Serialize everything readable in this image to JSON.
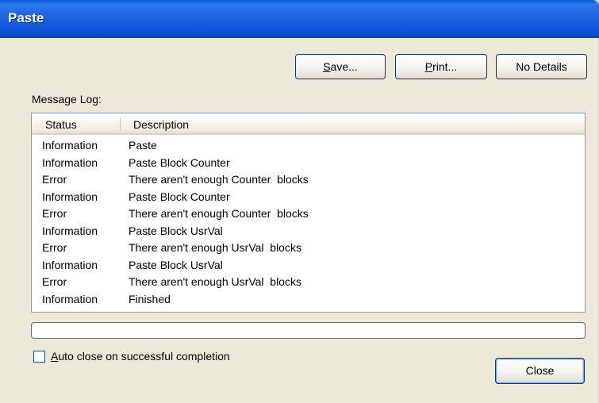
{
  "window": {
    "title": "Paste"
  },
  "toolbar": {
    "save_label": "Save...",
    "print_label": "Print...",
    "details_label": "No Details"
  },
  "log": {
    "label": "Message Log:",
    "columns": [
      "Status",
      "Description"
    ],
    "rows": [
      {
        "status": "Information",
        "description": "Paste"
      },
      {
        "status": "Information",
        "description": "Paste Block Counter"
      },
      {
        "status": "Error",
        "description": "There aren't enough Counter  blocks"
      },
      {
        "status": "Information",
        "description": "Paste Block Counter"
      },
      {
        "status": "Error",
        "description": "There aren't enough Counter  blocks"
      },
      {
        "status": "Information",
        "description": "Paste Block UsrVal"
      },
      {
        "status": "Error",
        "description": "There aren't enough UsrVal  blocks"
      },
      {
        "status": "Information",
        "description": "Paste Block UsrVal"
      },
      {
        "status": "Error",
        "description": "There aren't enough UsrVal  blocks"
      },
      {
        "status": "Information",
        "description": "Finished"
      }
    ]
  },
  "footer": {
    "auto_close_label": "Auto close on successful completion",
    "auto_close_checked": false,
    "close_label": "Close"
  }
}
